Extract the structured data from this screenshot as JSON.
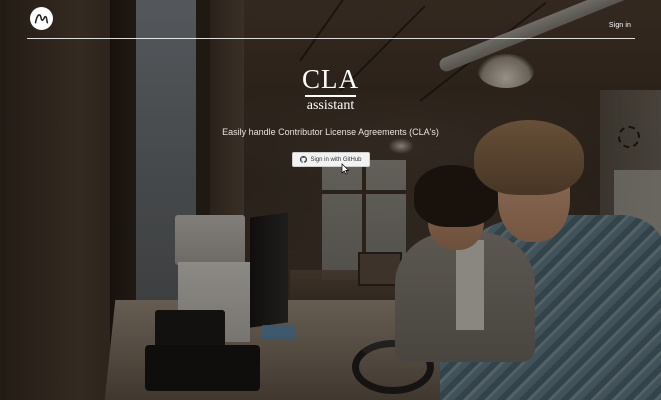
{
  "header": {
    "logo_icon": "cla-assistant-logo-icon",
    "signin_label": "Sign in"
  },
  "hero": {
    "title": "CLA",
    "subtitle": "assistant",
    "tagline": "Easily handle Contributor License Agreements (CLA's)",
    "button": {
      "label": "Sign in with GitHub",
      "icon": "github-icon"
    }
  },
  "colors": {
    "text": "#ffffff",
    "button_bg": "#f2f2f2",
    "button_text": "#333333"
  }
}
